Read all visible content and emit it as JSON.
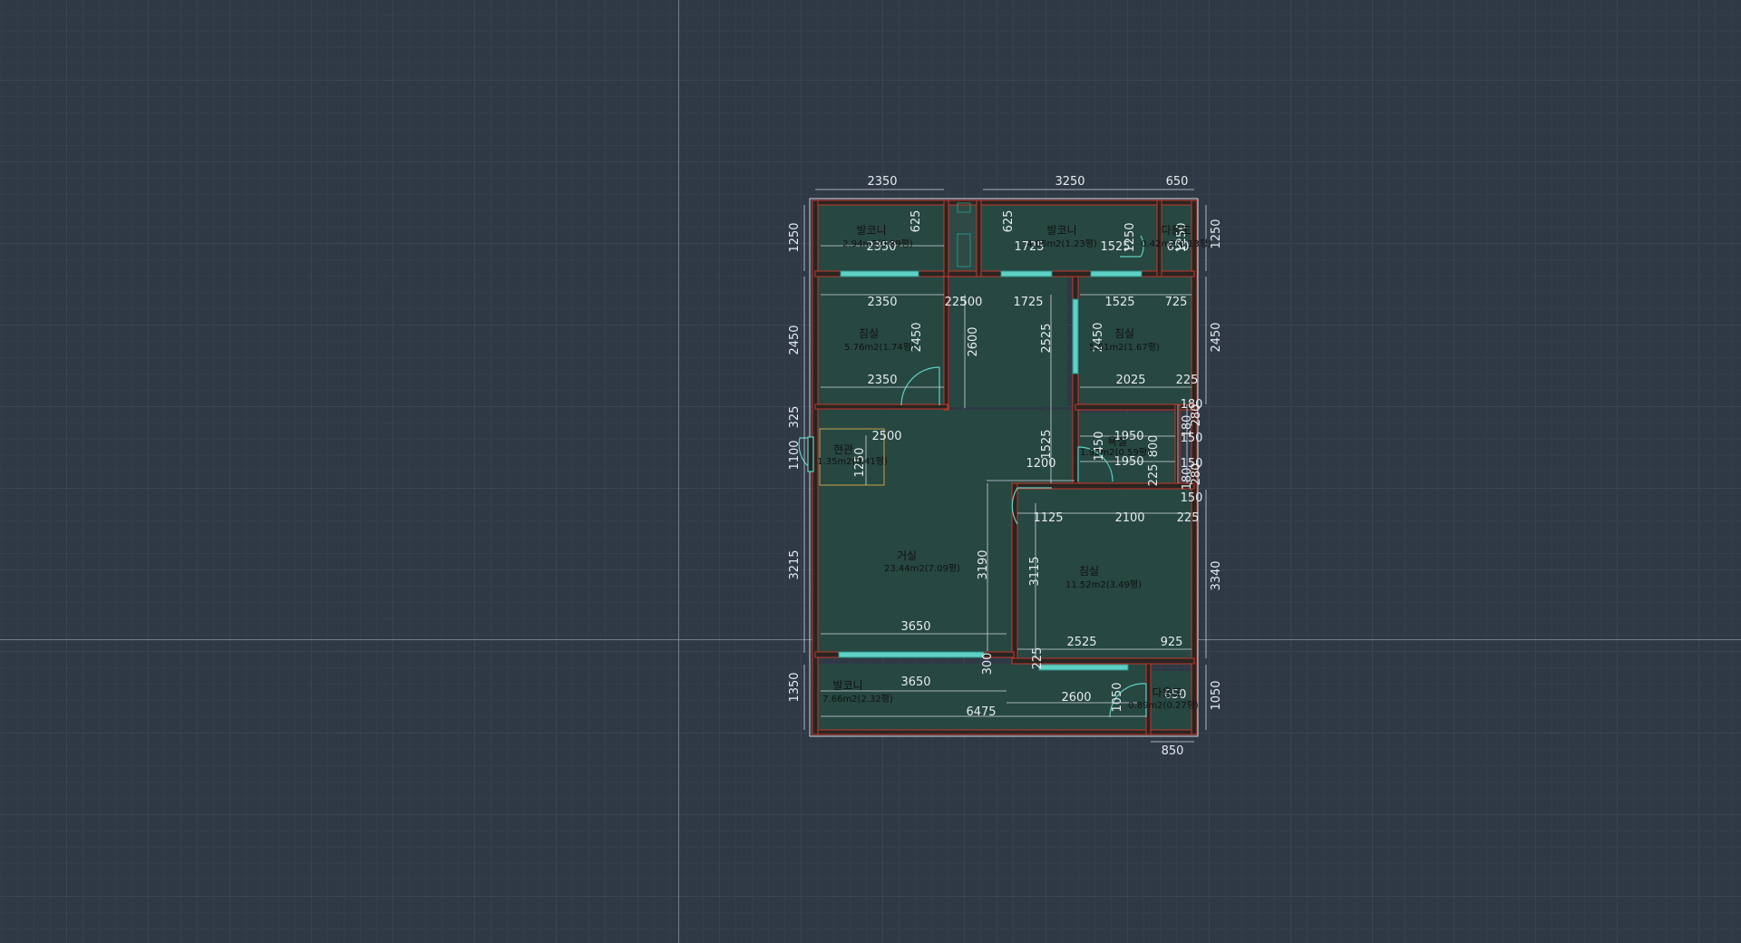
{
  "colors": {
    "background": "#2f3946",
    "room_fill": "#274741",
    "wall": "#2a2420",
    "wall_edge": "#c0392b",
    "window": "#5fd1c4",
    "dimension": "#e6ebef",
    "label": "#111111"
  },
  "rooms": [
    {
      "name": "발코니",
      "area": "2.94m2(0.89평)"
    },
    {
      "name": "발코니",
      "area": "4.05m2(1.23평)"
    },
    {
      "name": "침실",
      "area": "5.76m2(1.74평)"
    },
    {
      "name": "침실",
      "area": "5.51m2(1.67평)"
    },
    {
      "name": "욕실",
      "area": "1.95m2(0.59평)"
    },
    {
      "name": "거실",
      "area": "23.44m2(7.09평)"
    },
    {
      "name": "침실",
      "area": "11.52m2(3.49평)"
    },
    {
      "name": "발코니",
      "area": "7.66m2(2.32평)"
    },
    {
      "name": "현관",
      "area": "1.35m2(0.41평)"
    },
    {
      "name": "다용도",
      "area": "0.89m2(0.27평)"
    },
    {
      "name": "다용도",
      "area": "0.42m2(0.13평)"
    }
  ],
  "dimensions": {
    "top_1": "2350",
    "top_2": "3250",
    "top_3": "650",
    "left_1": "1250",
    "left_2": "2450",
    "left_3": "325",
    "left_4": "1100",
    "left_5": "3215",
    "left_6": "1350",
    "right_1": "1250",
    "right_2": "2450",
    "right_3": "3340",
    "right_4": "1050",
    "bottom_1": "850",
    "bal_w1": "2350",
    "bal_w2": "1725",
    "bal_w3": "1525",
    "bal_w4": "650",
    "bal_h1": "625",
    "bal_h2": "625",
    "bal_h3": "1250",
    "bal_h4": "1250",
    "bed1_w1": "2350",
    "bed1_w2": "2350",
    "bed1_h": "2450",
    "hall_w1": "225",
    "hall_w2": "500",
    "hall_w3": "1725",
    "hall_h1": "2600",
    "hall_h2": "2525",
    "hall_h3": "1525",
    "bed2_w1": "1525",
    "bed2_w2": "725",
    "bed2_w3": "2025",
    "bed2_w4": "225",
    "bed2_h": "2450",
    "bath_w1": "1950",
    "bath_w2": "1950",
    "bath_h1": "1450",
    "bath_h2": "800",
    "bath_h3": "225",
    "entry_w": "2500",
    "entry_h": "1250",
    "ut_h1": "180",
    "ut_h2": "150",
    "ut_h3": "150",
    "ut_h4": "180",
    "ut_h5": "150",
    "ut_h6": "280",
    "ut_h7": "180",
    "ut_h8": "280",
    "liv_w1": "1200",
    "liv_w2": "3650",
    "liv_h": "3190",
    "bed3_w1": "1125",
    "bed3_w2": "2100",
    "bed3_w3": "225",
    "bed3_w4": "2525",
    "bed3_w5": "925",
    "bed3_h": "3115",
    "bal3_w1": "3650",
    "bal3_w2": "2600",
    "bal3_w3": "6475",
    "bal3_h1": "300",
    "bal3_h2": "225",
    "bal3_h3": "1050",
    "bal3_w4": "650"
  }
}
